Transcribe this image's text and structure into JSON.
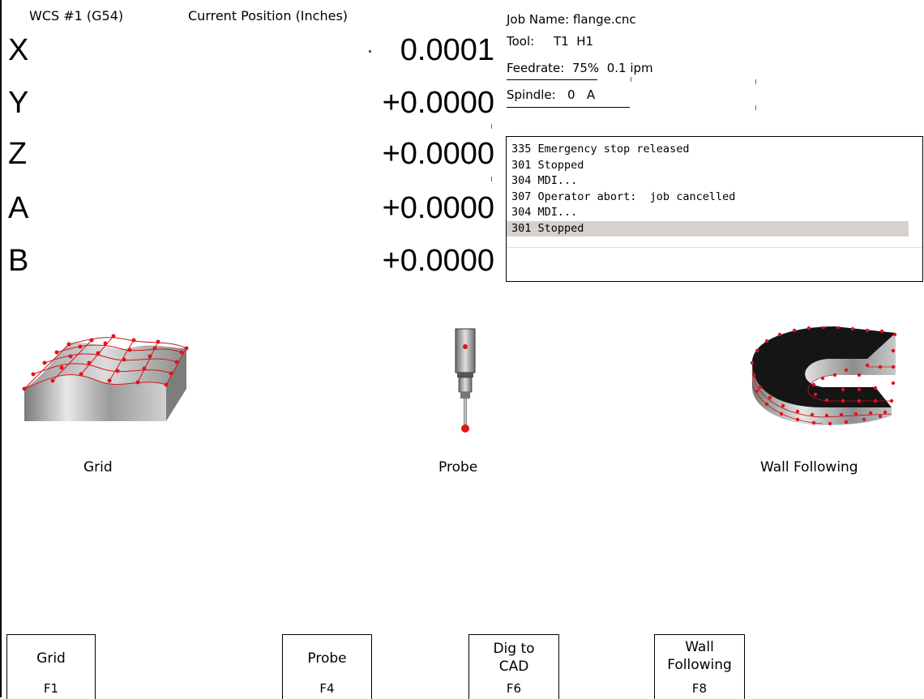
{
  "header": {
    "wcs": "WCS #1 (G54)",
    "position_title": "Current Position (Inches)"
  },
  "axes": [
    {
      "letter": "X",
      "value": "0.0001"
    },
    {
      "letter": "Y",
      "value": "+0.0000"
    },
    {
      "letter": "Z",
      "value": "+0.0000"
    },
    {
      "letter": "A",
      "value": "+0.0000"
    },
    {
      "letter": "B",
      "value": "+0.0000"
    }
  ],
  "status": {
    "job": "Job Name: flange.cnc",
    "tool": "Tool:     T1  H1",
    "feed": "Feedrate:  75%  0.1 ipm",
    "spindle": "Spindle:   0   A"
  },
  "messages": [
    "335 Emergency stop released",
    "301 Stopped",
    "304 MDI...",
    "307 Operator abort:  job cancelled",
    "304 MDI...",
    "301 Stopped"
  ],
  "tiles": {
    "grid": "Grid",
    "probe": "Probe",
    "wall": "Wall Following"
  },
  "fkeys": [
    {
      "label": "Grid",
      "key": "F1"
    },
    {
      "label": "Probe",
      "key": "F4"
    },
    {
      "label": "Dig to CAD",
      "key": "F6"
    },
    {
      "label": "Wall Following",
      "key": "F8"
    }
  ],
  "colors": {
    "point": "#e0141a",
    "selected_row": "#d6d1cc"
  }
}
